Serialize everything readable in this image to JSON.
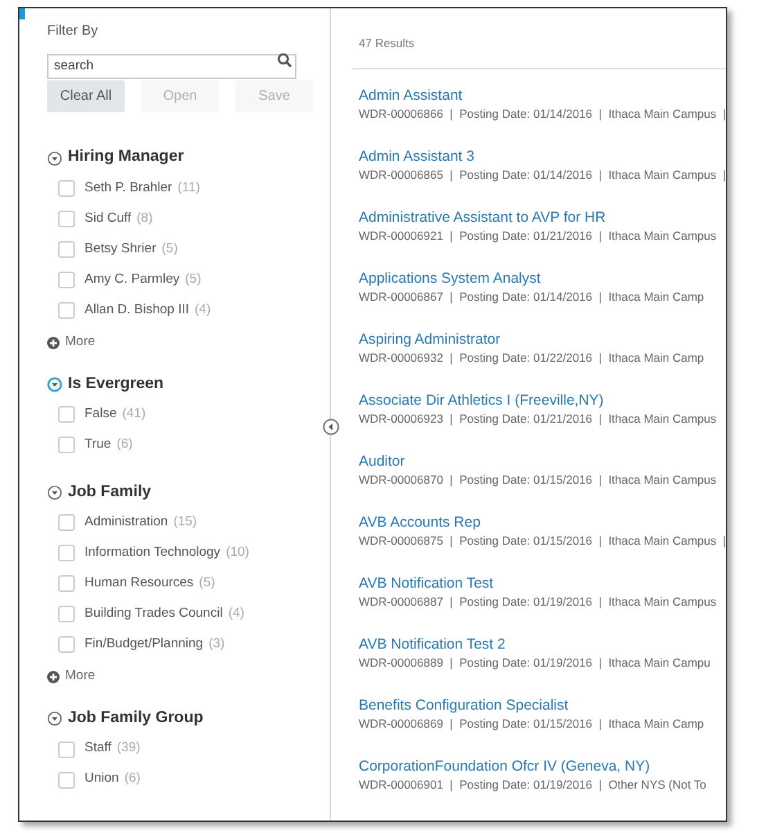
{
  "filter_panel": {
    "title": "Filter By",
    "search": {
      "placeholder": "search"
    },
    "buttons": [
      {
        "label": "Clear All",
        "disabled": false
      },
      {
        "label": "Open",
        "disabled": true
      },
      {
        "label": "Save",
        "disabled": true
      }
    ],
    "sections": [
      {
        "title": "Hiring Manager",
        "expanded": true,
        "focused": false,
        "items": [
          {
            "label": "Seth P. Brahler",
            "count": "(11)",
            "checked": false
          },
          {
            "label": "Sid Cuff",
            "count": "(8)",
            "checked": false
          },
          {
            "label": "Betsy Shrier",
            "count": "(5)",
            "checked": false
          },
          {
            "label": "Amy C. Parmley",
            "count": "(5)",
            "checked": false
          },
          {
            "label": "Allan D. Bishop III",
            "count": "(4)",
            "checked": false
          }
        ],
        "more": "More"
      },
      {
        "title": "Is Evergreen",
        "expanded": true,
        "focused": true,
        "items": [
          {
            "label": "False",
            "count": "(41)",
            "checked": false
          },
          {
            "label": "True",
            "count": "(6)",
            "checked": false
          }
        ]
      },
      {
        "title": "Job Family",
        "expanded": true,
        "focused": false,
        "items": [
          {
            "label": "Administration",
            "count": "(15)",
            "checked": false
          },
          {
            "label": "Information Technology",
            "count": "(10)",
            "checked": false
          },
          {
            "label": "Human Resources",
            "count": "(5)",
            "checked": false
          },
          {
            "label": "Building Trades Council",
            "count": "(4)",
            "checked": false
          },
          {
            "label": "Fin/Budget/Planning",
            "count": "(3)",
            "checked": false
          }
        ],
        "more": "More"
      },
      {
        "title": "Job Family Group",
        "expanded": true,
        "focused": false,
        "items": [
          {
            "label": "Staff",
            "count": "(39)",
            "checked": false
          },
          {
            "label": "Union",
            "count": "(6)",
            "checked": false
          }
        ]
      }
    ]
  },
  "results": {
    "count": "47 Results",
    "rows": [
      {
        "title": "Admin Assistant",
        "meta": "WDR-00006866  |  Posting Date: 01/14/2016  |  Ithaca Main Campus  |"
      },
      {
        "title": "Admin Assistant 3",
        "meta": "WDR-00006865  |  Posting Date: 01/14/2016  |  Ithaca Main Campus  |"
      },
      {
        "title": "Administrative Assistant to AVP for HR",
        "meta": "WDR-00006921  |  Posting Date: 01/21/2016  |  Ithaca Main Campus"
      },
      {
        "title": "Applications System Analyst",
        "meta": "WDR-00006867  |  Posting Date: 01/14/2016  |  Ithaca Main Camp"
      },
      {
        "title": "Aspiring Administrator",
        "meta": "WDR-00006932  |  Posting Date: 01/22/2016  |  Ithaca Main Camp"
      },
      {
        "title": "Associate Dir Athletics I (Freeville,NY)",
        "meta": "WDR-00006923  |  Posting Date: 01/21/2016  |  Ithaca Main Campus"
      },
      {
        "title": "Auditor",
        "meta": "WDR-00006870  |  Posting Date: 01/15/2016  |  Ithaca Main Campus"
      },
      {
        "title": "AVB Accounts Rep",
        "meta": "WDR-00006875  |  Posting Date: 01/15/2016  |  Ithaca Main Campus  |"
      },
      {
        "title": "AVB Notification Test",
        "meta": "WDR-00006887  |  Posting Date: 01/19/2016  |  Ithaca Main Campus"
      },
      {
        "title": "AVB Notification Test 2",
        "meta": "WDR-00006889  |  Posting Date: 01/19/2016  |  Ithaca Main Campu"
      },
      {
        "title": "Benefits Configuration Specialist",
        "meta": "WDR-00006869  |  Posting Date: 01/15/2016  |  Ithaca Main Camp"
      },
      {
        "title": "CorporationFoundation Ofcr IV (Geneva, NY)",
        "meta": "WDR-00006901  |  Posting Date: 01/19/2016  |  Other NYS (Not To"
      }
    ]
  }
}
